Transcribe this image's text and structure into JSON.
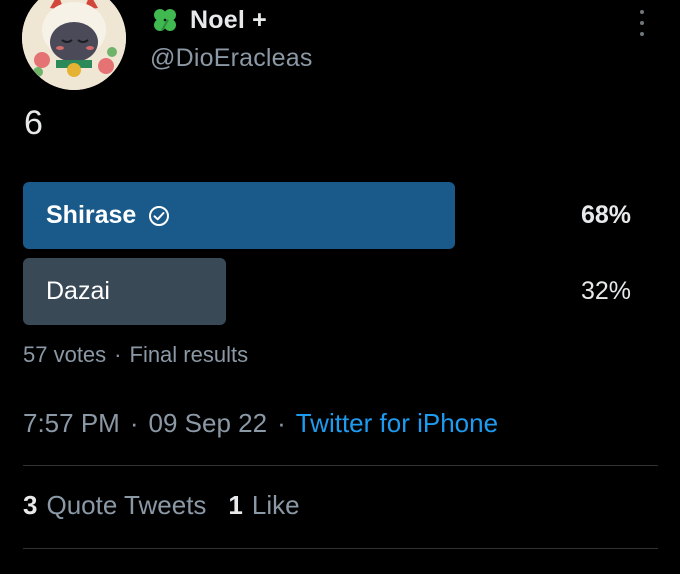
{
  "user": {
    "display_name": "Noel +",
    "handle": "@DioEracleas",
    "badge_icon": "four-leaf-clover-icon",
    "badge_color": "#3fb950"
  },
  "tweet": {
    "text": "6"
  },
  "poll": {
    "options": [
      {
        "label": "Shirase",
        "percent": "68%",
        "fraction": 0.68,
        "winner": true,
        "color": "#1a5a8a"
      },
      {
        "label": "Dazai",
        "percent": "32%",
        "fraction": 0.32,
        "winner": false,
        "color": "#3a4956"
      }
    ],
    "votes": "57 votes",
    "separator": "·",
    "status": "Final results"
  },
  "meta": {
    "time": "7:57 PM",
    "separator": "·",
    "date": "09 Sep 22",
    "source": "Twitter for iPhone",
    "source_color": "#1d9bf0"
  },
  "stats": {
    "quote_count": "3",
    "quote_label": "Quote Tweets",
    "like_count": "1",
    "like_label": "Like"
  }
}
